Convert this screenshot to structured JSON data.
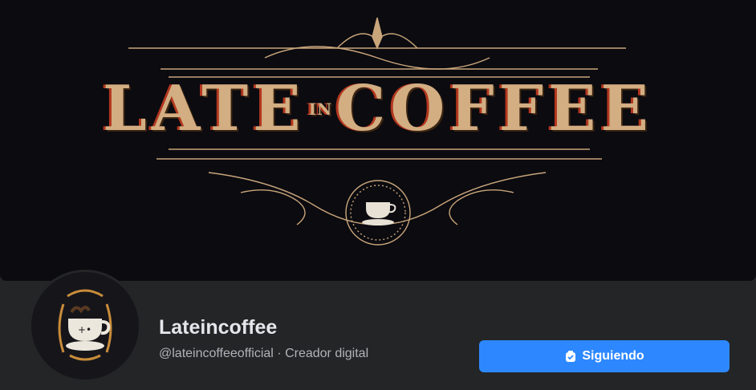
{
  "cover": {
    "logo_word_1": "LATE",
    "logo_word_small": "IN",
    "logo_word_2": "COFFEE",
    "colors": {
      "background": "#0b0b10",
      "gold": "#d2ae82",
      "accent_red": "#b3361e"
    }
  },
  "profile": {
    "name": "Lateincoffee",
    "handle": "@lateincoffeeofficial",
    "separator": " · ",
    "category": "Creador digital",
    "avatar_icon": "coffee-cup-logo-icon"
  },
  "actions": {
    "following_label": "Siguiendo",
    "following_icon": "check-badge-icon",
    "button_color": "#2d88ff"
  }
}
